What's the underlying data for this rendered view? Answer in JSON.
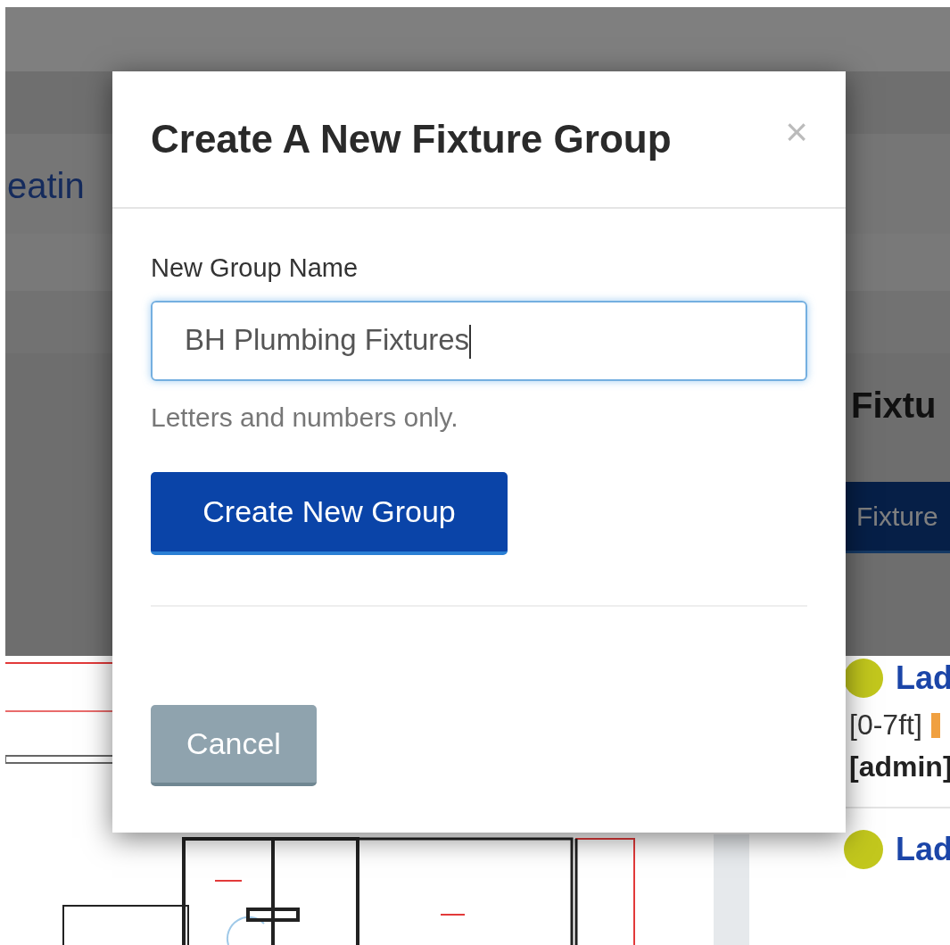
{
  "background": {
    "heading_fragment": "eatin",
    "panel_title": "Fixtu",
    "panel_button": "Fixture",
    "list_items": [
      {
        "title": "Lad",
        "color": "#c2c71d",
        "lines": [
          "[0-7ft]",
          "[admin]"
        ]
      },
      {
        "title": "Lad",
        "color": "#c2c71d"
      }
    ]
  },
  "dialog": {
    "title": "Create A New Fixture Group",
    "close": "×",
    "field": {
      "label": "New Group Name",
      "value": "BH Plumbing Fixtures",
      "focused": true,
      "help": "Letters and numbers only."
    },
    "primary_button": "Create New Group",
    "cancel_button": "Cancel"
  }
}
